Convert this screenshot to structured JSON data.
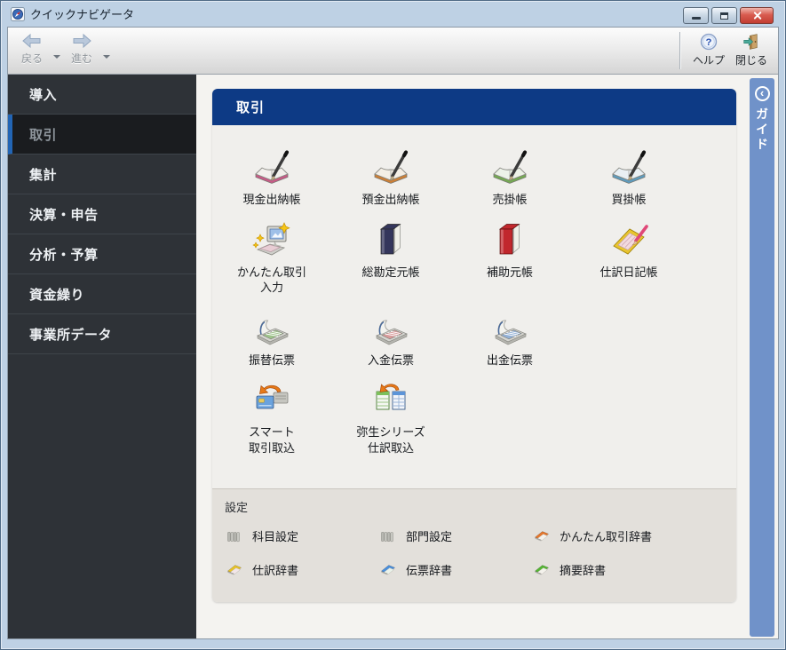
{
  "window": {
    "title": "クイックナビゲータ"
  },
  "toolbar": {
    "back": "戻る",
    "forward": "進む",
    "help": "ヘルプ",
    "help_glyph": "?",
    "close": "閉じる"
  },
  "sidebar": {
    "items": [
      {
        "label": "導入",
        "selected": false
      },
      {
        "label": "取引",
        "selected": true
      },
      {
        "label": "集計",
        "selected": false
      },
      {
        "label": "決算・申告",
        "selected": false
      },
      {
        "label": "分析・予算",
        "selected": false
      },
      {
        "label": "資金繰り",
        "selected": false
      },
      {
        "label": "事業所データ",
        "selected": false
      }
    ]
  },
  "main": {
    "header": "取引",
    "items": [
      {
        "label": "現金出納帳",
        "icon": "ledger-pen-icon",
        "color": "#c75a86"
      },
      {
        "label": "預金出納帳",
        "icon": "ledger-pen-icon",
        "color": "#cd7f35"
      },
      {
        "label": "売掛帳",
        "icon": "ledger-pen-icon",
        "color": "#74a952"
      },
      {
        "label": "買掛帳",
        "icon": "ledger-pen-icon",
        "color": "#5e9bbd"
      },
      {
        "label": "かんたん取引\n入力",
        "icon": "computer-sparkle-icon",
        "color": "#f5c518"
      },
      {
        "label": "総勘定元帳",
        "icon": "standing-book-icon",
        "color": "#34365c"
      },
      {
        "label": "補助元帳",
        "icon": "standing-book-icon",
        "color": "#c1272d"
      },
      {
        "label": "仕訳日記帳",
        "icon": "notepad-pencil-icon",
        "color": "#e9c52e"
      },
      {
        "label": "振替伝票",
        "icon": "slip-pad-icon",
        "color": "#9dc38a"
      },
      {
        "label": "入金伝票",
        "icon": "slip-pad-icon",
        "color": "#d89b9b"
      },
      {
        "label": "出金伝票",
        "icon": "slip-pad-icon",
        "color": "#93b1d6"
      },
      {
        "label": "スマート\n取引取込",
        "icon": "import-cards-icon",
        "color": "#e87a18"
      },
      {
        "label": "弥生シリーズ\n仕訳取込",
        "icon": "import-sheets-icon",
        "color": "#e87a18"
      }
    ]
  },
  "settings": {
    "header": "設定",
    "items": [
      {
        "label": "科目設定",
        "icon": "gray-books-icon",
        "color": "#b9b9b3"
      },
      {
        "label": "部門設定",
        "icon": "gray-books-icon",
        "color": "#b9b9b3"
      },
      {
        "label": "かんたん取引辞書",
        "icon": "dictionary-icon",
        "color": "#e5762a"
      },
      {
        "label": "仕訳辞書",
        "icon": "dictionary-icon",
        "color": "#e8c327"
      },
      {
        "label": "伝票辞書",
        "icon": "dictionary-icon",
        "color": "#4a8fdc"
      },
      {
        "label": "摘要辞書",
        "icon": "dictionary-icon",
        "color": "#55b633"
      }
    ]
  },
  "guide": {
    "label": "ガイド",
    "chevron": "‹"
  }
}
